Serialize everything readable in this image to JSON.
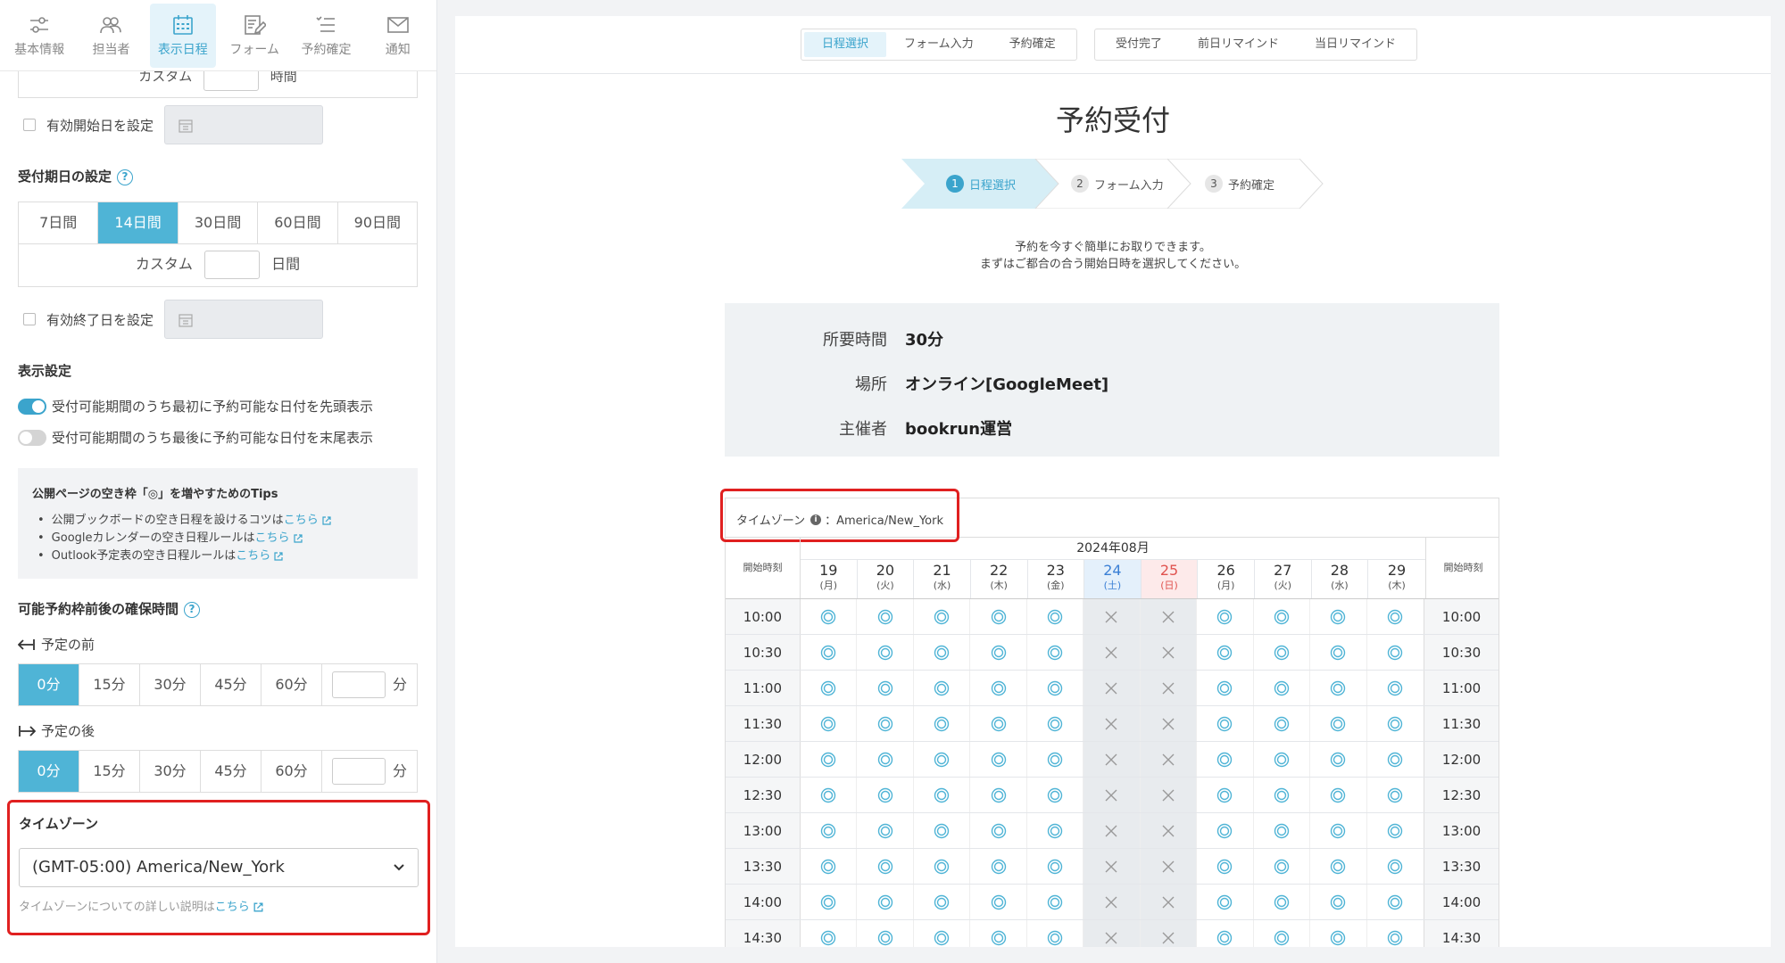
{
  "tabs": [
    {
      "label": "基本情報",
      "icon": "sliders-icon",
      "active": false
    },
    {
      "label": "担当者",
      "icon": "people-icon",
      "active": false
    },
    {
      "label": "表示日程",
      "icon": "calendar-icon",
      "active": true
    },
    {
      "label": "フォーム",
      "icon": "form-edit-icon",
      "active": false
    },
    {
      "label": "予約確定",
      "icon": "checklist-icon",
      "active": false
    },
    {
      "label": "通知",
      "icon": "mail-icon",
      "active": false
    }
  ],
  "custom_top": {
    "label": "カスタム",
    "unit": "時間"
  },
  "start_date": {
    "label": "有効開始日を設定"
  },
  "period": {
    "title": "受付期日の設定",
    "options": [
      "7日間",
      "14日間",
      "30日間",
      "60日間",
      "90日間"
    ],
    "selected": "14日間",
    "custom_label": "カスタム",
    "custom_unit": "日間"
  },
  "end_date": {
    "label": "有効終了日を設定"
  },
  "display": {
    "title": "表示設定",
    "toggle1": "受付可能期間のうち最初に予約可能な日付を先頭表示",
    "toggle2": "受付可能期間のうち最後に予約可能な日付を末尾表示"
  },
  "tips": {
    "title": "公開ページの空き枠「◎」を増やすためのTips",
    "items": [
      {
        "text": "公開ブックボードの空き日程を設けるコツは",
        "link": "こちら"
      },
      {
        "text": "Googleカレンダーの空き日程ルールは",
        "link": "こちら"
      },
      {
        "text": "Outlook予定表の空き日程ルールは",
        "link": "こちら"
      }
    ]
  },
  "buffer": {
    "title": "可能予約枠前後の確保時間",
    "before_label": "予定の前",
    "after_label": "予定の後",
    "options": [
      "0分",
      "15分",
      "30分",
      "45分",
      "60分"
    ],
    "unit": "分",
    "selected": "0分"
  },
  "timezone": {
    "title": "タイムゾーン",
    "value": "(GMT-05:00) America/New_York",
    "help_text": "タイムゾーンについての詳しい説明は",
    "help_link": "こちら"
  },
  "preview_tabs": {
    "group1": [
      "日程選択",
      "フォーム入力",
      "予約確定"
    ],
    "group2": [
      "受付完了",
      "前日リマインド",
      "当日リマインド"
    ],
    "active": "日程選択"
  },
  "page_title": "予約受付",
  "steps": [
    {
      "num": "1",
      "label": "日程選択"
    },
    {
      "num": "2",
      "label": "フォーム入力"
    },
    {
      "num": "3",
      "label": "予約確定"
    }
  ],
  "intro_line1": "予約を今すぐ簡単にお取りできます。",
  "intro_line2": "まずはご都合の合う開始日時を選択してください。",
  "event_info": [
    {
      "key": "所要時間",
      "value": "30分"
    },
    {
      "key": "場所",
      "value": "オンライン[GoogleMeet]"
    },
    {
      "key": "主催者",
      "value": "bookrun運営"
    }
  ],
  "calendar": {
    "timezone_label": "タイムゾーン",
    "timezone_value": "：America/New_York",
    "month": "2024年08月",
    "start_time_header": "開始時刻",
    "days": [
      {
        "d": "19",
        "w": "(月)",
        "type": "weekday"
      },
      {
        "d": "20",
        "w": "(火)",
        "type": "weekday"
      },
      {
        "d": "21",
        "w": "(水)",
        "type": "weekday"
      },
      {
        "d": "22",
        "w": "(木)",
        "type": "weekday"
      },
      {
        "d": "23",
        "w": "(金)",
        "type": "weekday"
      },
      {
        "d": "24",
        "w": "(土)",
        "type": "sat"
      },
      {
        "d": "25",
        "w": "(日)",
        "type": "sun"
      },
      {
        "d": "26",
        "w": "(月)",
        "type": "weekday"
      },
      {
        "d": "27",
        "w": "(火)",
        "type": "weekday"
      },
      {
        "d": "28",
        "w": "(水)",
        "type": "weekday"
      },
      {
        "d": "29",
        "w": "(木)",
        "type": "weekday"
      }
    ],
    "times": [
      "10:00",
      "10:30",
      "11:00",
      "11:30",
      "12:00",
      "12:30",
      "13:00",
      "13:30",
      "14:00",
      "14:30"
    ],
    "available_symbol": "available-circle-icon",
    "unavailable_symbol": "unavailable-x-icon"
  },
  "colors": {
    "accent": "#4fb4d6",
    "highlight": "#e02020",
    "saturday": "#3a7fd5",
    "sunday": "#e0534f"
  }
}
